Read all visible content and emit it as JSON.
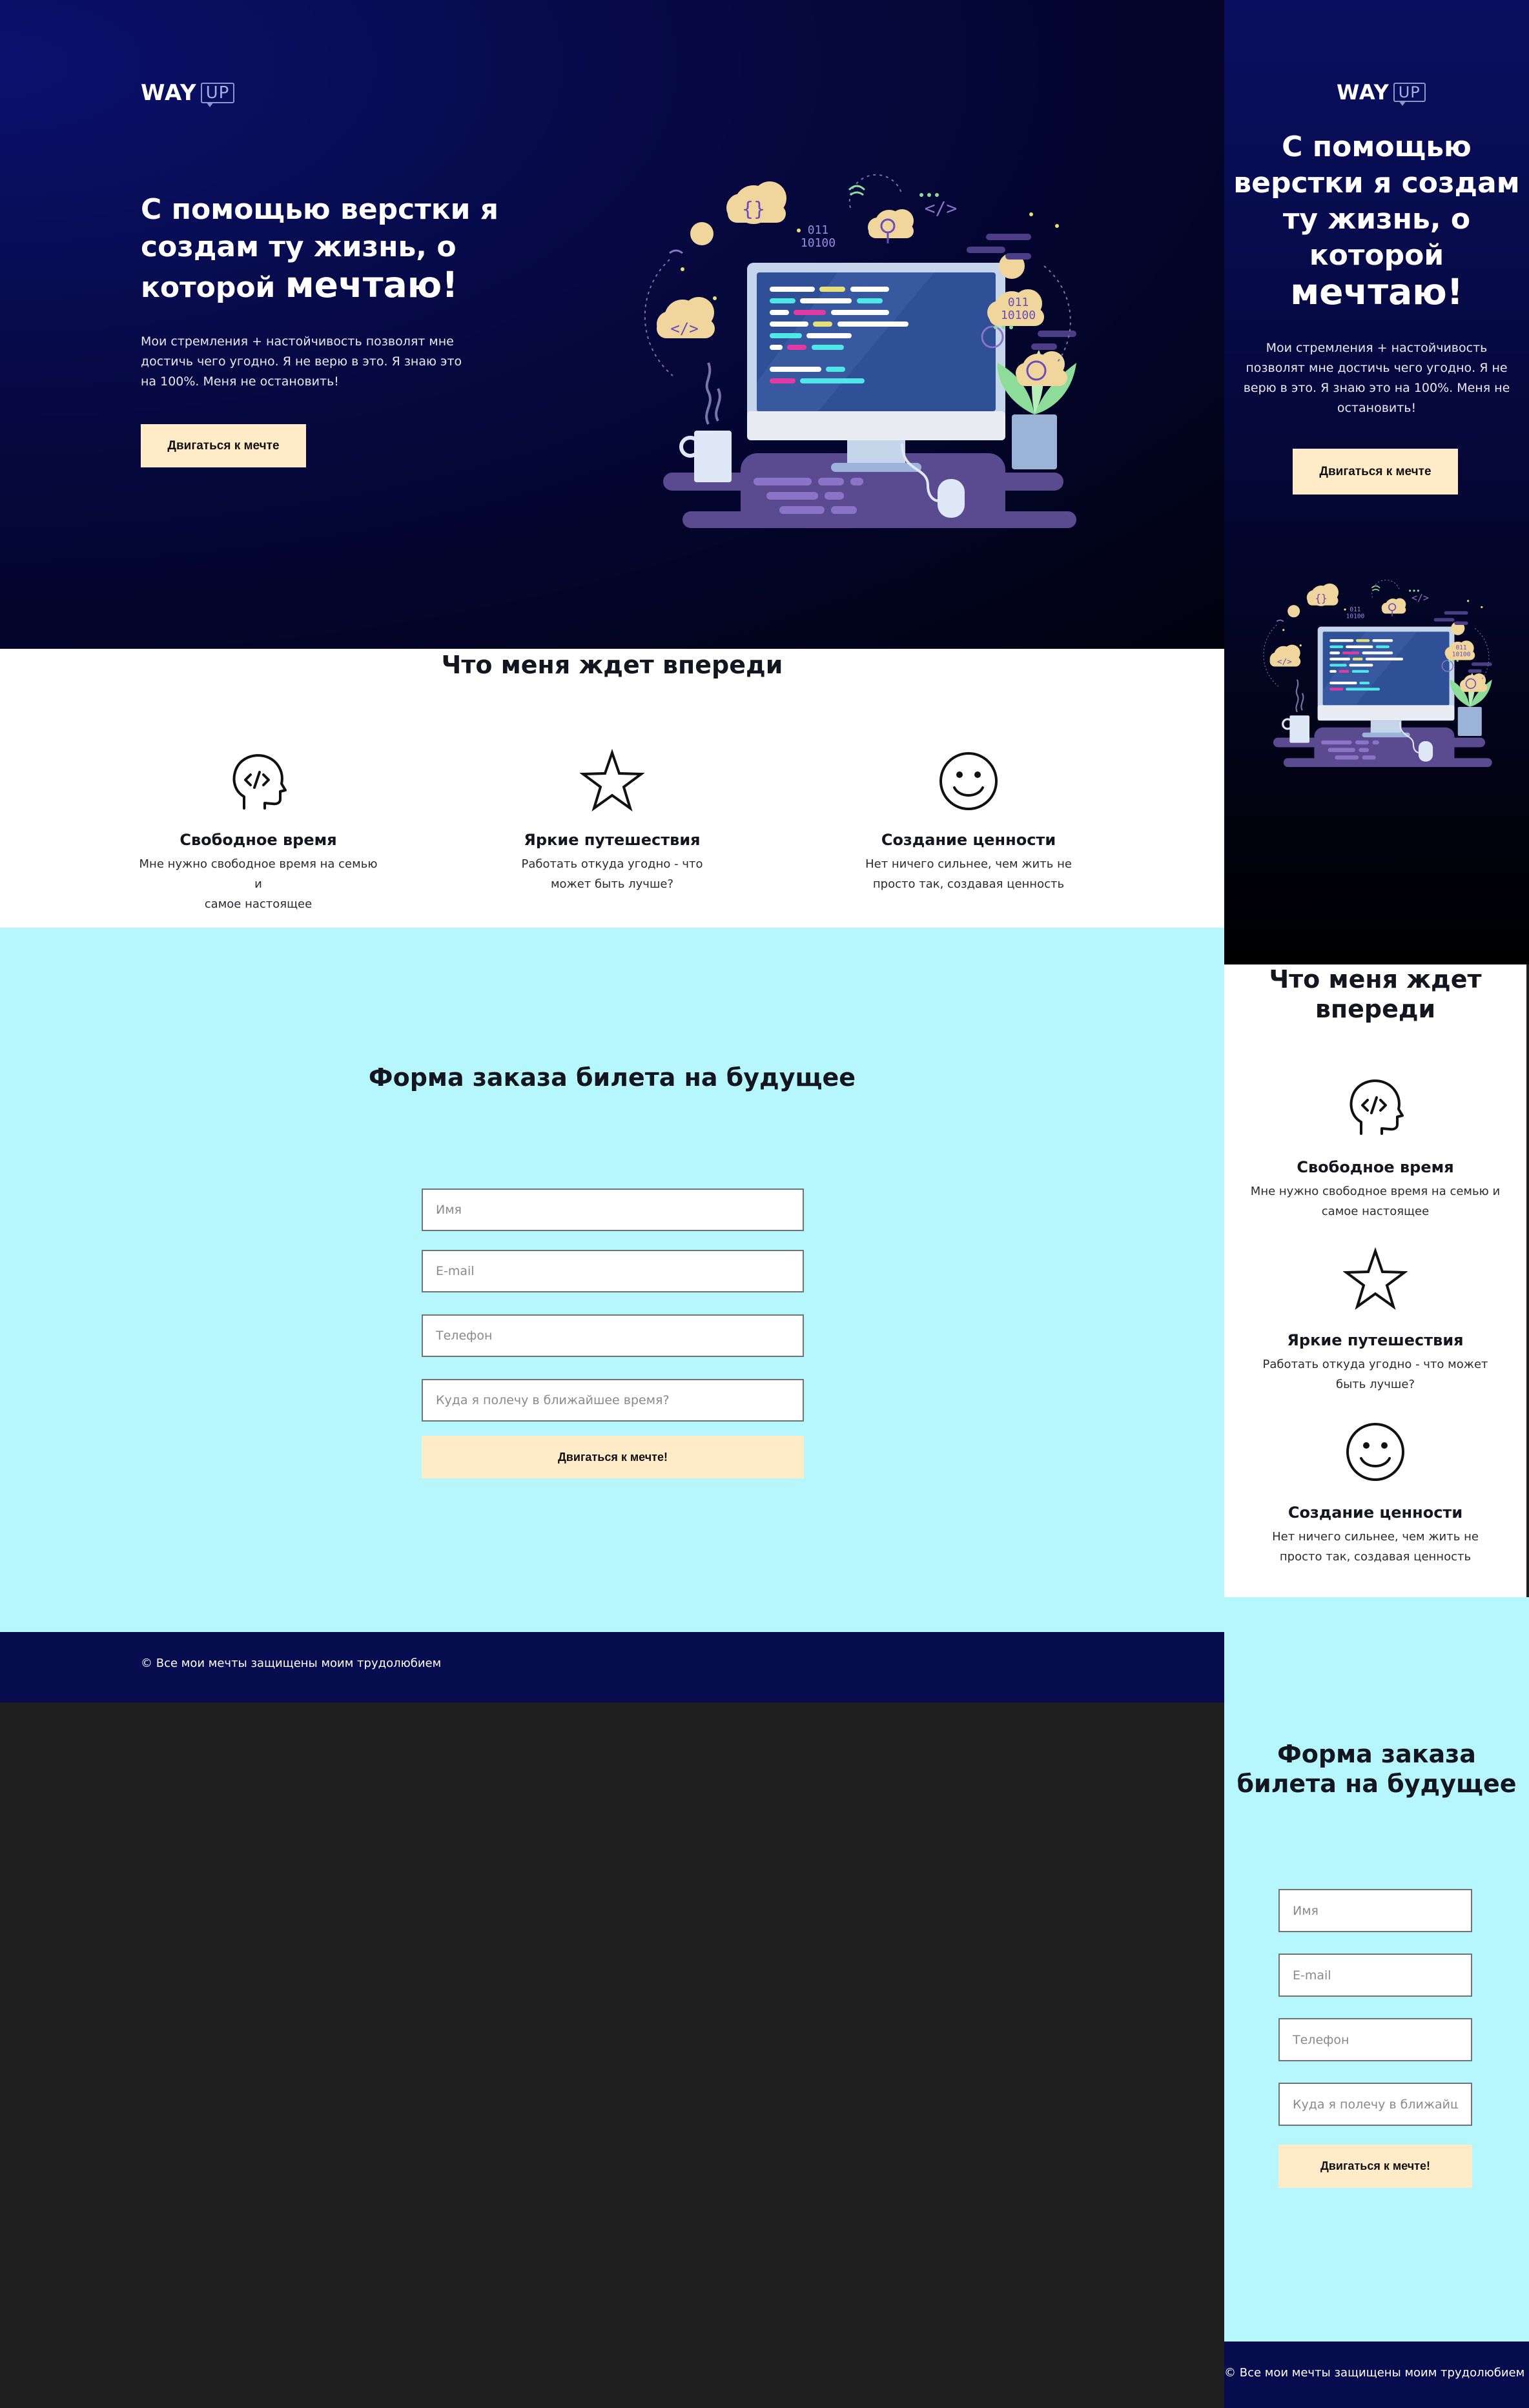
{
  "logo": {
    "main": "WAY",
    "badge": "UP"
  },
  "hero": {
    "title_part1": "С помощью верстки я создам ту жизнь, о которой",
    "title_part2": "мечтаю!",
    "desc": "Мои стремления + настойчивость позволят мне достичь чего угодно. Я не верю в это. Я знаю это на 100%. Меня не остановить!",
    "cta": "Двигаться к мечте"
  },
  "features": {
    "title": "Что меня ждет впереди",
    "items": [
      {
        "icon": "head-code-icon",
        "title": "Свободное время",
        "desc_desktop": "Мне нужно свободное время на семью\nи\nсамое настоящее",
        "desc_mobile": "Мне нужно свободное время на семью и самое настоящее"
      },
      {
        "icon": "star-icon",
        "title": "Яркие путешествия",
        "desc_desktop": "Работать откуда угодно - что может быть лучше?",
        "desc_mobile": "Работать откуда угодно - что может быть лучше?"
      },
      {
        "icon": "smiley-icon",
        "title": "Создание ценности",
        "desc_desktop": "Нет ничего сильнее, чем жить не просто так, создавая ценность",
        "desc_mobile": "Нет ничего сильнее, чем жить не просто так, создавая ценность"
      }
    ]
  },
  "form": {
    "title": "Форма заказа билета на будущее",
    "name_placeholder": "Имя",
    "email_placeholder": "E-mail",
    "phone_placeholder": "Телефон",
    "destination_placeholder": "Куда я полечу в ближайшее время?",
    "submit": "Двигаться к мечте!"
  },
  "footer": {
    "copyright": "© Все мои мечты защищены моим трудолюбием"
  },
  "illustration": {
    "code_text_1": "011",
    "code_text_2": "10100",
    "code_text_3": "011",
    "code_text_4": "10100"
  },
  "colors": {
    "hero_dark": "#03052a",
    "accent_cream": "#ffebc8",
    "form_bg": "#b6f7fd",
    "footer_bg": "#070c4f",
    "outer_bg": "#1e1e1e"
  }
}
